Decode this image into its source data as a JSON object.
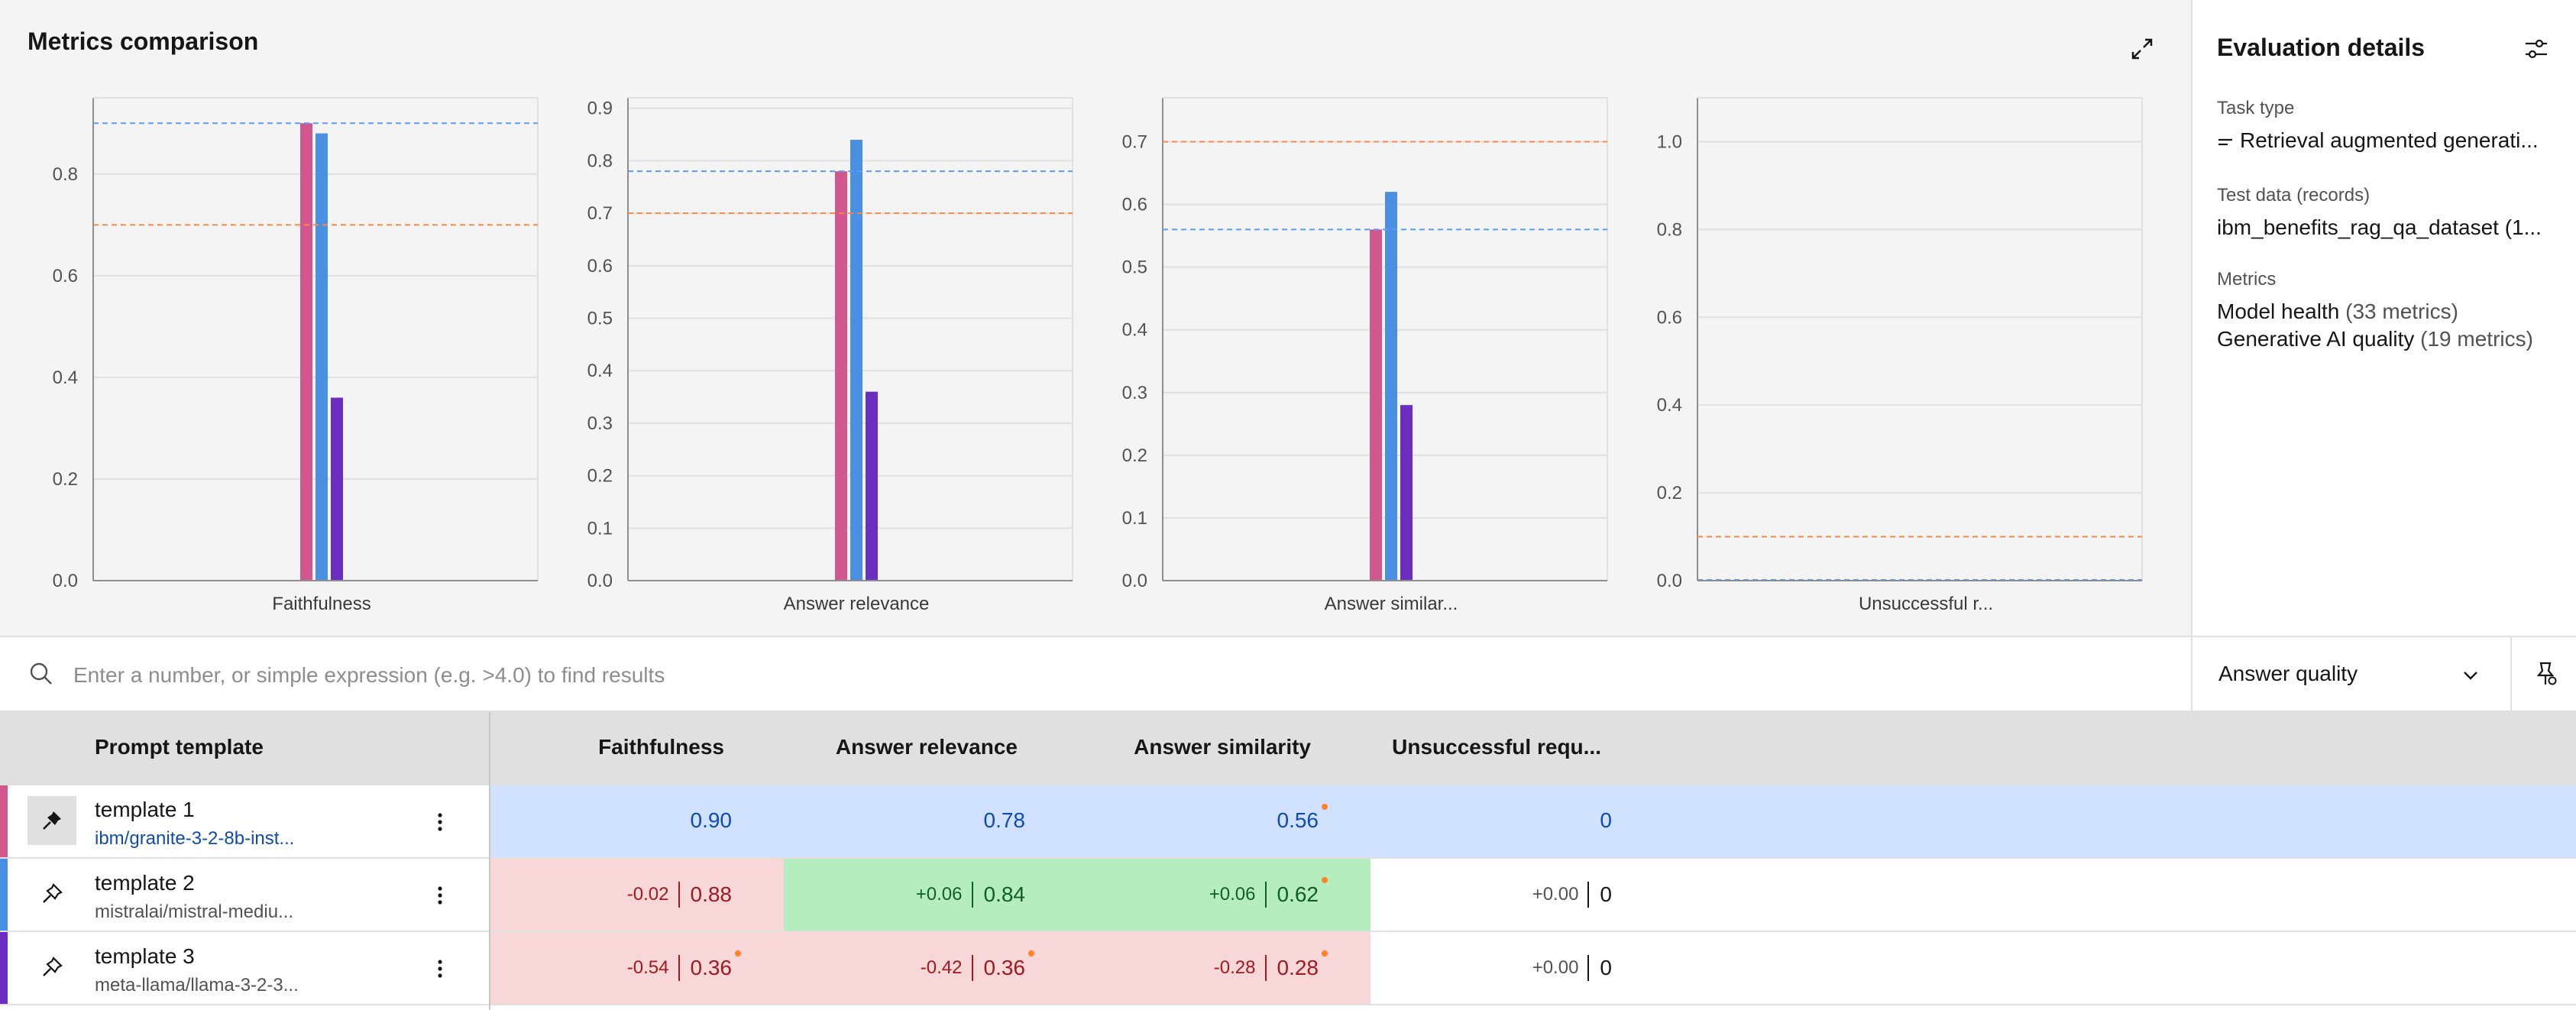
{
  "metrics_panel": {
    "title": "Metrics comparison",
    "expand_icon": "expand-icon"
  },
  "colors": {
    "template_1": "#d2578e",
    "template_2": "#4a90e2",
    "template_3": "#6c2ec2",
    "threshold_blue": "#5b9bff",
    "threshold_orange": "#f28a45",
    "baseline_row": "#d0e2ff",
    "worse_cell": "#f8d7d8",
    "better_cell": "#b5edbf"
  },
  "chart_data": [
    {
      "type": "bar",
      "title": "",
      "xlabel": "Faithfulness",
      "ylim": [
        0,
        0.95
      ],
      "yticks": [
        "0.0",
        "0.2",
        "0.4",
        "0.6",
        "0.8"
      ],
      "series": [
        {
          "name": "template 1",
          "values": [
            0.9
          ]
        },
        {
          "name": "template 2",
          "values": [
            0.88
          ]
        },
        {
          "name": "template 3",
          "values": [
            0.36
          ]
        }
      ],
      "thresholds": [
        0.9,
        0.7
      ],
      "grid": true
    },
    {
      "type": "bar",
      "title": "",
      "xlabel": "Answer relevance",
      "ylim": [
        0,
        0.92
      ],
      "yticks": [
        "0.0",
        "0.1",
        "0.2",
        "0.3",
        "0.4",
        "0.5",
        "0.6",
        "0.7",
        "0.8",
        "0.9"
      ],
      "series": [
        {
          "name": "template 1",
          "values": [
            0.78
          ]
        },
        {
          "name": "template 2",
          "values": [
            0.84
          ]
        },
        {
          "name": "template 3",
          "values": [
            0.36
          ]
        }
      ],
      "thresholds": [
        0.78,
        0.7
      ],
      "grid": true
    },
    {
      "type": "bar",
      "title": "",
      "xlabel": "Answer similar...",
      "ylim": [
        0,
        0.77
      ],
      "yticks": [
        "0.0",
        "0.1",
        "0.2",
        "0.3",
        "0.4",
        "0.5",
        "0.6",
        "0.7"
      ],
      "series": [
        {
          "name": "template 1",
          "values": [
            0.56
          ]
        },
        {
          "name": "template 2",
          "values": [
            0.62
          ]
        },
        {
          "name": "template 3",
          "values": [
            0.28
          ]
        }
      ],
      "thresholds": [
        0.56,
        0.7
      ],
      "grid": true
    },
    {
      "type": "bar",
      "title": "",
      "xlabel": "Unsuccessful r...",
      "ylim": [
        0,
        1.1
      ],
      "yticks": [
        "0.0",
        "0.2",
        "0.4",
        "0.6",
        "0.8",
        "1.0"
      ],
      "series": [
        {
          "name": "template 1",
          "values": [
            0
          ]
        },
        {
          "name": "template 2",
          "values": [
            0
          ]
        },
        {
          "name": "template 3",
          "values": [
            0
          ]
        }
      ],
      "thresholds": [
        0,
        0.1
      ],
      "grid": true
    }
  ],
  "details": {
    "title": "Evaluation details",
    "settings_icon": "settings-adjust-icon",
    "task_type_label": "Task type",
    "task_type_value": "Retrieval augmented generati...",
    "task_type_icon": "text-lines-icon",
    "test_data_label": "Test data (records)",
    "test_data_value": "ibm_benefits_rag_qa_dataset (1...",
    "metrics_label": "Metrics",
    "metrics_line1_name": "Model health",
    "metrics_line1_count": "(33 metrics)",
    "metrics_line2_name": "Generative AI quality",
    "metrics_line2_count": "(19 metrics)"
  },
  "search": {
    "placeholder": "Enter a number, or simple expression (e.g. >4.0) to find results",
    "value": "",
    "icon": "search-icon"
  },
  "filter": {
    "selected": "Answer quality",
    "icon": "chevron-down-icon"
  },
  "pin_settings_icon": "pin-settings-icon",
  "table": {
    "columns": [
      "Prompt template",
      "Faithfulness",
      "Answer relevance",
      "Answer similarity",
      "Unsuccessful requ..."
    ],
    "rows": [
      {
        "name": "template 1",
        "model": "ibm/granite-3-2-8b-inst...",
        "pinned": true,
        "cells": [
          {
            "delta": "",
            "value": "0.90",
            "flag": false
          },
          {
            "delta": "",
            "value": "0.78",
            "flag": false
          },
          {
            "delta": "",
            "value": "0.56",
            "flag": true
          },
          {
            "delta": "",
            "value": "0",
            "flag": false
          }
        ]
      },
      {
        "name": "template 2",
        "model": "mistralai/mistral-mediu...",
        "pinned": false,
        "cells": [
          {
            "delta": "-0.02",
            "value": "0.88",
            "flag": false
          },
          {
            "delta": "+0.06",
            "value": "0.84",
            "flag": false
          },
          {
            "delta": "+0.06",
            "value": "0.62",
            "flag": true
          },
          {
            "delta": "+0.00",
            "value": "0",
            "flag": false
          }
        ]
      },
      {
        "name": "template 3",
        "model": "meta-llama/llama-3-2-3...",
        "pinned": false,
        "cells": [
          {
            "delta": "-0.54",
            "value": "0.36",
            "flag": true
          },
          {
            "delta": "-0.42",
            "value": "0.36",
            "flag": true
          },
          {
            "delta": "-0.28",
            "value": "0.28",
            "flag": true
          },
          {
            "delta": "+0.00",
            "value": "0",
            "flag": false
          }
        ]
      }
    ]
  }
}
